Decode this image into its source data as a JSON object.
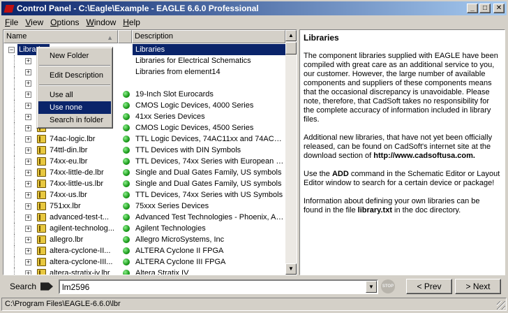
{
  "window": {
    "title": "Control Panel - C:\\Eagle\\Example - EAGLE 6.6.0 Professional",
    "controls": {
      "minimize": "_",
      "maximize": "□",
      "close": "✕"
    }
  },
  "menu": [
    {
      "label": "File",
      "key": "F",
      "rest": "ile"
    },
    {
      "label": "View",
      "key": "V",
      "rest": "iew"
    },
    {
      "label": "Options",
      "key": "O",
      "rest": "ptions"
    },
    {
      "label": "Window",
      "key": "W",
      "rest": "indow"
    },
    {
      "label": "Help",
      "key": "H",
      "rest": "elp"
    }
  ],
  "tree": {
    "columns": {
      "name": "Name",
      "description": "Description"
    },
    "root": {
      "name": "Libraries",
      "description": "Libraries"
    },
    "items": [
      {
        "name": "",
        "description": "Libraries for Electrical Schematics",
        "in_use": false
      },
      {
        "name": "",
        "description": "Libraries from element14",
        "in_use": false
      },
      {
        "name": "",
        "description": "",
        "in_use": false
      },
      {
        "name": "",
        "description": "19-Inch Slot Eurocards",
        "in_use": true
      },
      {
        "name": "",
        "description": "CMOS Logic Devices, 4000 Series",
        "in_use": true
      },
      {
        "name": "",
        "description": "41xx Series Devices",
        "in_use": true
      },
      {
        "name": "",
        "description": "CMOS Logic Devices, 4500 Series",
        "in_use": true
      },
      {
        "name": "74ac-logic.lbr",
        "description": "TTL Logic Devices, 74AC11xx and 74AC16...",
        "in_use": true
      },
      {
        "name": "74ttl-din.lbr",
        "description": "TTL Devices with DIN Symbols",
        "in_use": true
      },
      {
        "name": "74xx-eu.lbr",
        "description": "TTL Devices, 74xx Series with European S...",
        "in_use": true
      },
      {
        "name": "74xx-little-de.lbr",
        "description": "Single and Dual Gates Family, US symbols",
        "in_use": true
      },
      {
        "name": "74xx-little-us.lbr",
        "description": "Single and Dual Gates Family, US symbols",
        "in_use": true
      },
      {
        "name": "74xx-us.lbr",
        "description": "TTL Devices, 74xx Series with US Symbols",
        "in_use": true
      },
      {
        "name": "751xx.lbr",
        "description": "75xxx Series Devices",
        "in_use": true
      },
      {
        "name": "advanced-test-t...",
        "description": "Advanced Test Technologies - Phoenix, Ari...",
        "in_use": true
      },
      {
        "name": "agilent-technolog...",
        "description": "Agilent Technologies",
        "in_use": true
      },
      {
        "name": "allegro.lbr",
        "description": "Allegro MicroSystems, Inc",
        "in_use": true
      },
      {
        "name": "altera-cyclone-II...",
        "description": "ALTERA Cyclone II FPGA",
        "in_use": true
      },
      {
        "name": "altera-cyclone-III...",
        "description": "ALTERA Cyclone III FPGA",
        "in_use": true
      },
      {
        "name": "altera-stratix-iv.lbr",
        "description": "Altera Stratix IV",
        "in_use": true
      }
    ]
  },
  "context_menu": [
    {
      "label": "New Folder",
      "highlighted": false
    },
    {
      "separator": true
    },
    {
      "label": "Edit Description",
      "highlighted": false
    },
    {
      "separator": true
    },
    {
      "label": "Use all",
      "highlighted": false
    },
    {
      "label": "Use none",
      "highlighted": true
    },
    {
      "label": "Search in folder",
      "highlighted": false
    }
  ],
  "info": {
    "heading": "Libraries",
    "p1": "The component libraries supplied with EAGLE have been compiled with great care as an additional service to you, our customer. However, the large number of available components and suppliers of these components means that the occasional discrepancy is unavoidable. Please note, therefore, that CadSoft takes no responsibility for the complete accuracy of information included in library files.",
    "p2_pre": "Additional new libraries, that have not yet been officially released, can be found on CadSoft's internet site at the download section of ",
    "p2_link": "http://www.cadsoftusa.com.",
    "p3_pre": "Use the ",
    "p3_cmd": "ADD",
    "p3_post": " command in the Schematic Editor or Layout Editor window to search for a certain device or package!",
    "p4_pre": "Information about defining your own libraries can be found in the file ",
    "p4_file": "library.txt",
    "p4_post": " in the doc directory."
  },
  "search": {
    "label": "Search",
    "value": "lm2596",
    "stop_label": "STOP",
    "prev_label": "< Prev",
    "next_label": "> Next"
  },
  "status": {
    "path": "C:\\Program Files\\EAGLE-6.6.0\\lbr"
  },
  "colors": {
    "selection": "#0a246a",
    "title_start": "#0a246a",
    "title_end": "#a6caf0",
    "in_use_dot": "#1a9a1a"
  }
}
